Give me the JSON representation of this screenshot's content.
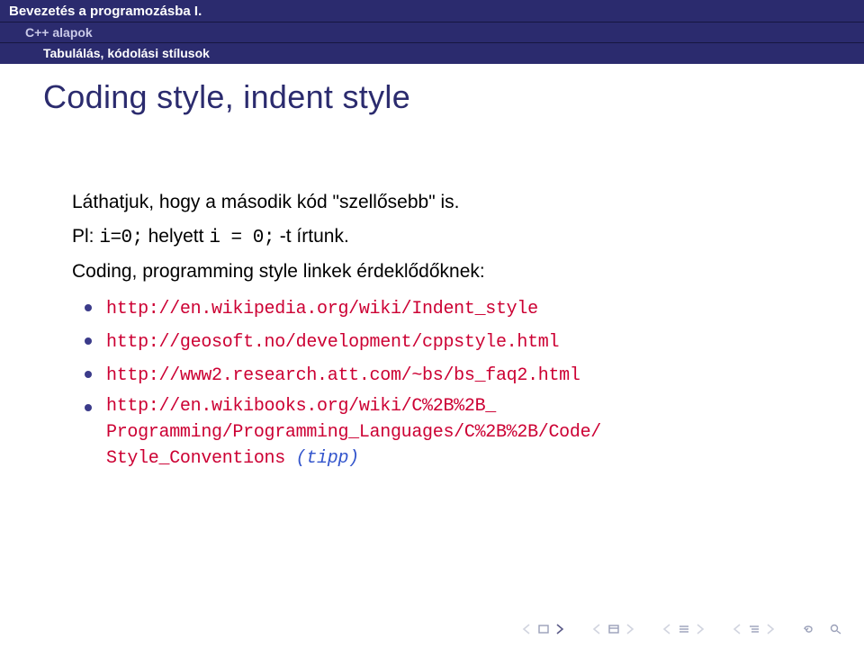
{
  "header": {
    "breadcrumb1": "Bevezetés a programozásba I.",
    "breadcrumb2": "C++ alapok",
    "breadcrumb3": "Tabulálás, kódolási stílusok"
  },
  "title": "Coding style, indent style",
  "body": {
    "line1_a": "Láthatjuk, hogy a második kód \"szellősebb\" is.",
    "line2_prefix": "Pl: ",
    "line2_code1": "i=0;",
    "line2_mid": " helyett ",
    "line2_code2": "i = 0;",
    "line2_suffix": " -t írtunk.",
    "line3": "Coding, programming style linkek érdeklődőknek:"
  },
  "links": {
    "l1": "http://en.wikipedia.org/wiki/Indent_style",
    "l2": "http://geosoft.no/development/cppstyle.html",
    "l3": "http://www2.research.att.com/~bs/bs_faq2.html",
    "l4a": "http://en.wikibooks.org/wiki/C%2B%2B_",
    "l4b": "Programming/Programming_Languages/C%2B%2B/Code/",
    "l4c": "Style_Conventions",
    "l4_suffix": " (tipp)"
  }
}
